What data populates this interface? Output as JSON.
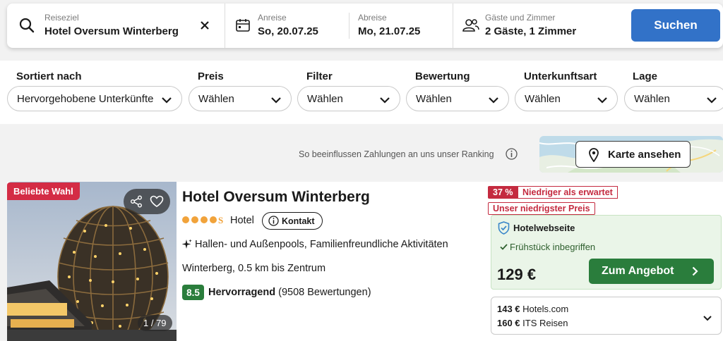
{
  "search": {
    "destination_label": "Reiseziel",
    "destination_value": "Hotel Oversum Winterberg",
    "checkin_label": "Anreise",
    "checkin_value": "So, 20.07.25",
    "checkout_label": "Abreise",
    "checkout_value": "Mo, 21.07.25",
    "guests_label": "Gäste und Zimmer",
    "guests_value": "2 Gäste, 1 Zimmer",
    "search_button": "Suchen"
  },
  "filters": [
    {
      "label": "Sortiert nach",
      "value": "Hervorgehobene Unterkünfte"
    },
    {
      "label": "Preis",
      "value": "Wählen"
    },
    {
      "label": "Filter",
      "value": "Wählen"
    },
    {
      "label": "Bewertung",
      "value": "Wählen"
    },
    {
      "label": "Unterkunftsart",
      "value": "Wählen"
    },
    {
      "label": "Lage",
      "value": "Wählen"
    }
  ],
  "ranking_note": "So beeinflussen Zahlungen an uns unser Ranking",
  "map_button": "Karte ansehen",
  "hotel": {
    "badge": "Beliebte Wahl",
    "photo_counter": "1 / 79",
    "name": "Hotel Oversum Winterberg",
    "stars": 4,
    "stars_suffix": "S",
    "type": "Hotel",
    "contact_button": "Kontakt",
    "amenities": "Hallen- und Außenpools, Familienfreundliche Aktivitäten",
    "location": "Winterberg, 0.5 km bis Zentrum",
    "rating_score": "8.5",
    "rating_word": "Hervorragend",
    "rating_count": "(9508 Bewertungen)"
  },
  "deal": {
    "discount": "37 %",
    "discount_text": "Niedriger als erwartet",
    "lowest_price_tag": "Unser niedrigster Preis",
    "provider": "Hotelwebseite",
    "breakfast": "Frühstück inbegriffen",
    "price": "129 €",
    "button": "Zum Angebot"
  },
  "alternatives": [
    {
      "price": "143 €",
      "provider": "Hotels.com"
    },
    {
      "price": "160 €",
      "provider": "ITS Reisen"
    }
  ],
  "colors": {
    "accent_blue": "#3272c8",
    "deal_green": "#2a7d3c",
    "badge_red": "#d42c45",
    "star_orange": "#f1a33b"
  }
}
